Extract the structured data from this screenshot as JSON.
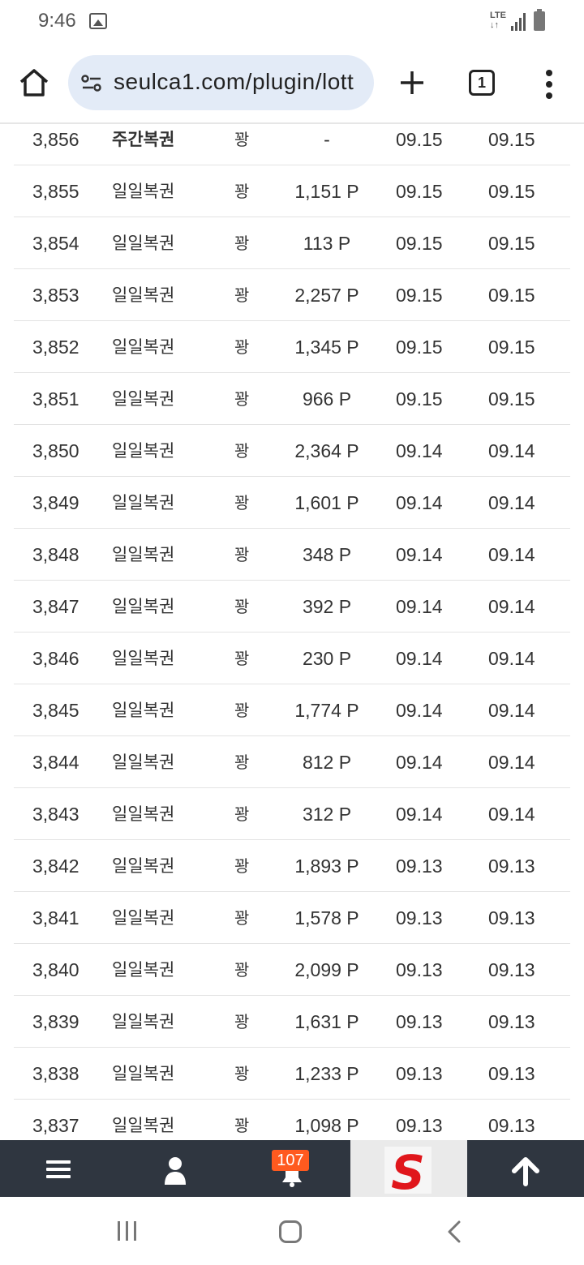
{
  "status_bar": {
    "time": "9:46",
    "network": "LTE",
    "icons": [
      "photo-icon",
      "lte-icon",
      "signal-icon",
      "battery-icon"
    ]
  },
  "browser": {
    "url": "seulca1.com/plugin/lott",
    "tab_count": "1"
  },
  "table": {
    "rows": [
      {
        "no": "3,856",
        "name": "주간복권",
        "result": "꽝",
        "point": "-",
        "date1": "09.15",
        "date2": "09.15",
        "bold": true
      },
      {
        "no": "3,855",
        "name": "일일복권",
        "result": "꽝",
        "point": "1,151 P",
        "date1": "09.15",
        "date2": "09.15"
      },
      {
        "no": "3,854",
        "name": "일일복권",
        "result": "꽝",
        "point": "113 P",
        "date1": "09.15",
        "date2": "09.15"
      },
      {
        "no": "3,853",
        "name": "일일복권",
        "result": "꽝",
        "point": "2,257 P",
        "date1": "09.15",
        "date2": "09.15"
      },
      {
        "no": "3,852",
        "name": "일일복권",
        "result": "꽝",
        "point": "1,345 P",
        "date1": "09.15",
        "date2": "09.15"
      },
      {
        "no": "3,851",
        "name": "일일복권",
        "result": "꽝",
        "point": "966 P",
        "date1": "09.15",
        "date2": "09.15"
      },
      {
        "no": "3,850",
        "name": "일일복권",
        "result": "꽝",
        "point": "2,364 P",
        "date1": "09.14",
        "date2": "09.14"
      },
      {
        "no": "3,849",
        "name": "일일복권",
        "result": "꽝",
        "point": "1,601 P",
        "date1": "09.14",
        "date2": "09.14"
      },
      {
        "no": "3,848",
        "name": "일일복권",
        "result": "꽝",
        "point": "348 P",
        "date1": "09.14",
        "date2": "09.14"
      },
      {
        "no": "3,847",
        "name": "일일복권",
        "result": "꽝",
        "point": "392 P",
        "date1": "09.14",
        "date2": "09.14"
      },
      {
        "no": "3,846",
        "name": "일일복권",
        "result": "꽝",
        "point": "230 P",
        "date1": "09.14",
        "date2": "09.14"
      },
      {
        "no": "3,845",
        "name": "일일복권",
        "result": "꽝",
        "point": "1,774 P",
        "date1": "09.14",
        "date2": "09.14"
      },
      {
        "no": "3,844",
        "name": "일일복권",
        "result": "꽝",
        "point": "812 P",
        "date1": "09.14",
        "date2": "09.14"
      },
      {
        "no": "3,843",
        "name": "일일복권",
        "result": "꽝",
        "point": "312 P",
        "date1": "09.14",
        "date2": "09.14"
      },
      {
        "no": "3,842",
        "name": "일일복권",
        "result": "꽝",
        "point": "1,893 P",
        "date1": "09.13",
        "date2": "09.13"
      },
      {
        "no": "3,841",
        "name": "일일복권",
        "result": "꽝",
        "point": "1,578 P",
        "date1": "09.13",
        "date2": "09.13"
      },
      {
        "no": "3,840",
        "name": "일일복권",
        "result": "꽝",
        "point": "2,099 P",
        "date1": "09.13",
        "date2": "09.13"
      },
      {
        "no": "3,839",
        "name": "일일복권",
        "result": "꽝",
        "point": "1,631 P",
        "date1": "09.13",
        "date2": "09.13"
      },
      {
        "no": "3,838",
        "name": "일일복권",
        "result": "꽝",
        "point": "1,233 P",
        "date1": "09.13",
        "date2": "09.13"
      },
      {
        "no": "3,837",
        "name": "일일복권",
        "result": "꽝",
        "point": "1,098 P",
        "date1": "09.13",
        "date2": "09.13"
      }
    ]
  },
  "site_nav": {
    "notification_count": "107",
    "items": [
      "menu-icon",
      "user-icon",
      "bell-icon",
      "site-logo",
      "arrow-up-icon"
    ],
    "logo_letter": "S",
    "logo_color": "#e0161b",
    "badge_color": "#ff5a1f",
    "bar_color": "#2f3640"
  }
}
